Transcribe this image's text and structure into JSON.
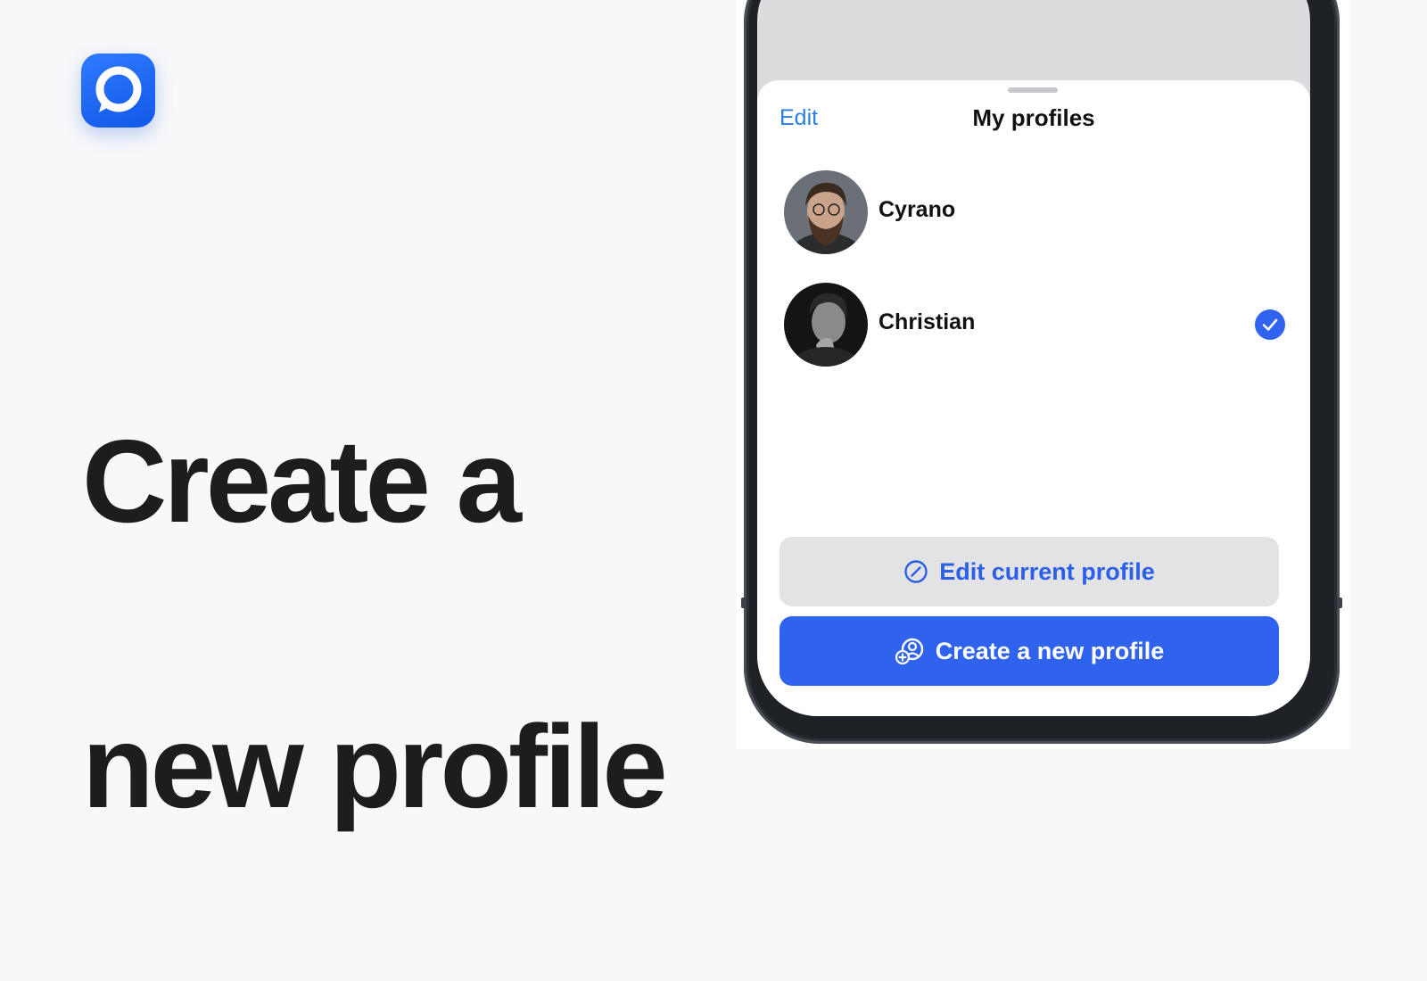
{
  "brand": {
    "logo_icon": "chat-bubble-icon",
    "accent": "#1760ee"
  },
  "headline": {
    "line1": "Create a",
    "line2": "new profile"
  },
  "sheet": {
    "edit_label": "Edit",
    "title": "My profiles",
    "profiles": [
      {
        "name": "Cyrano",
        "selected": false
      },
      {
        "name": "Christian",
        "selected": true
      }
    ],
    "edit_current_label": "Edit current profile",
    "create_new_label": "Create a new profile"
  },
  "colors": {
    "link": "#2a7ee0",
    "primary_button": "#2f63ee",
    "secondary_button": "#e3e3e6",
    "check": "#2f63f0"
  }
}
